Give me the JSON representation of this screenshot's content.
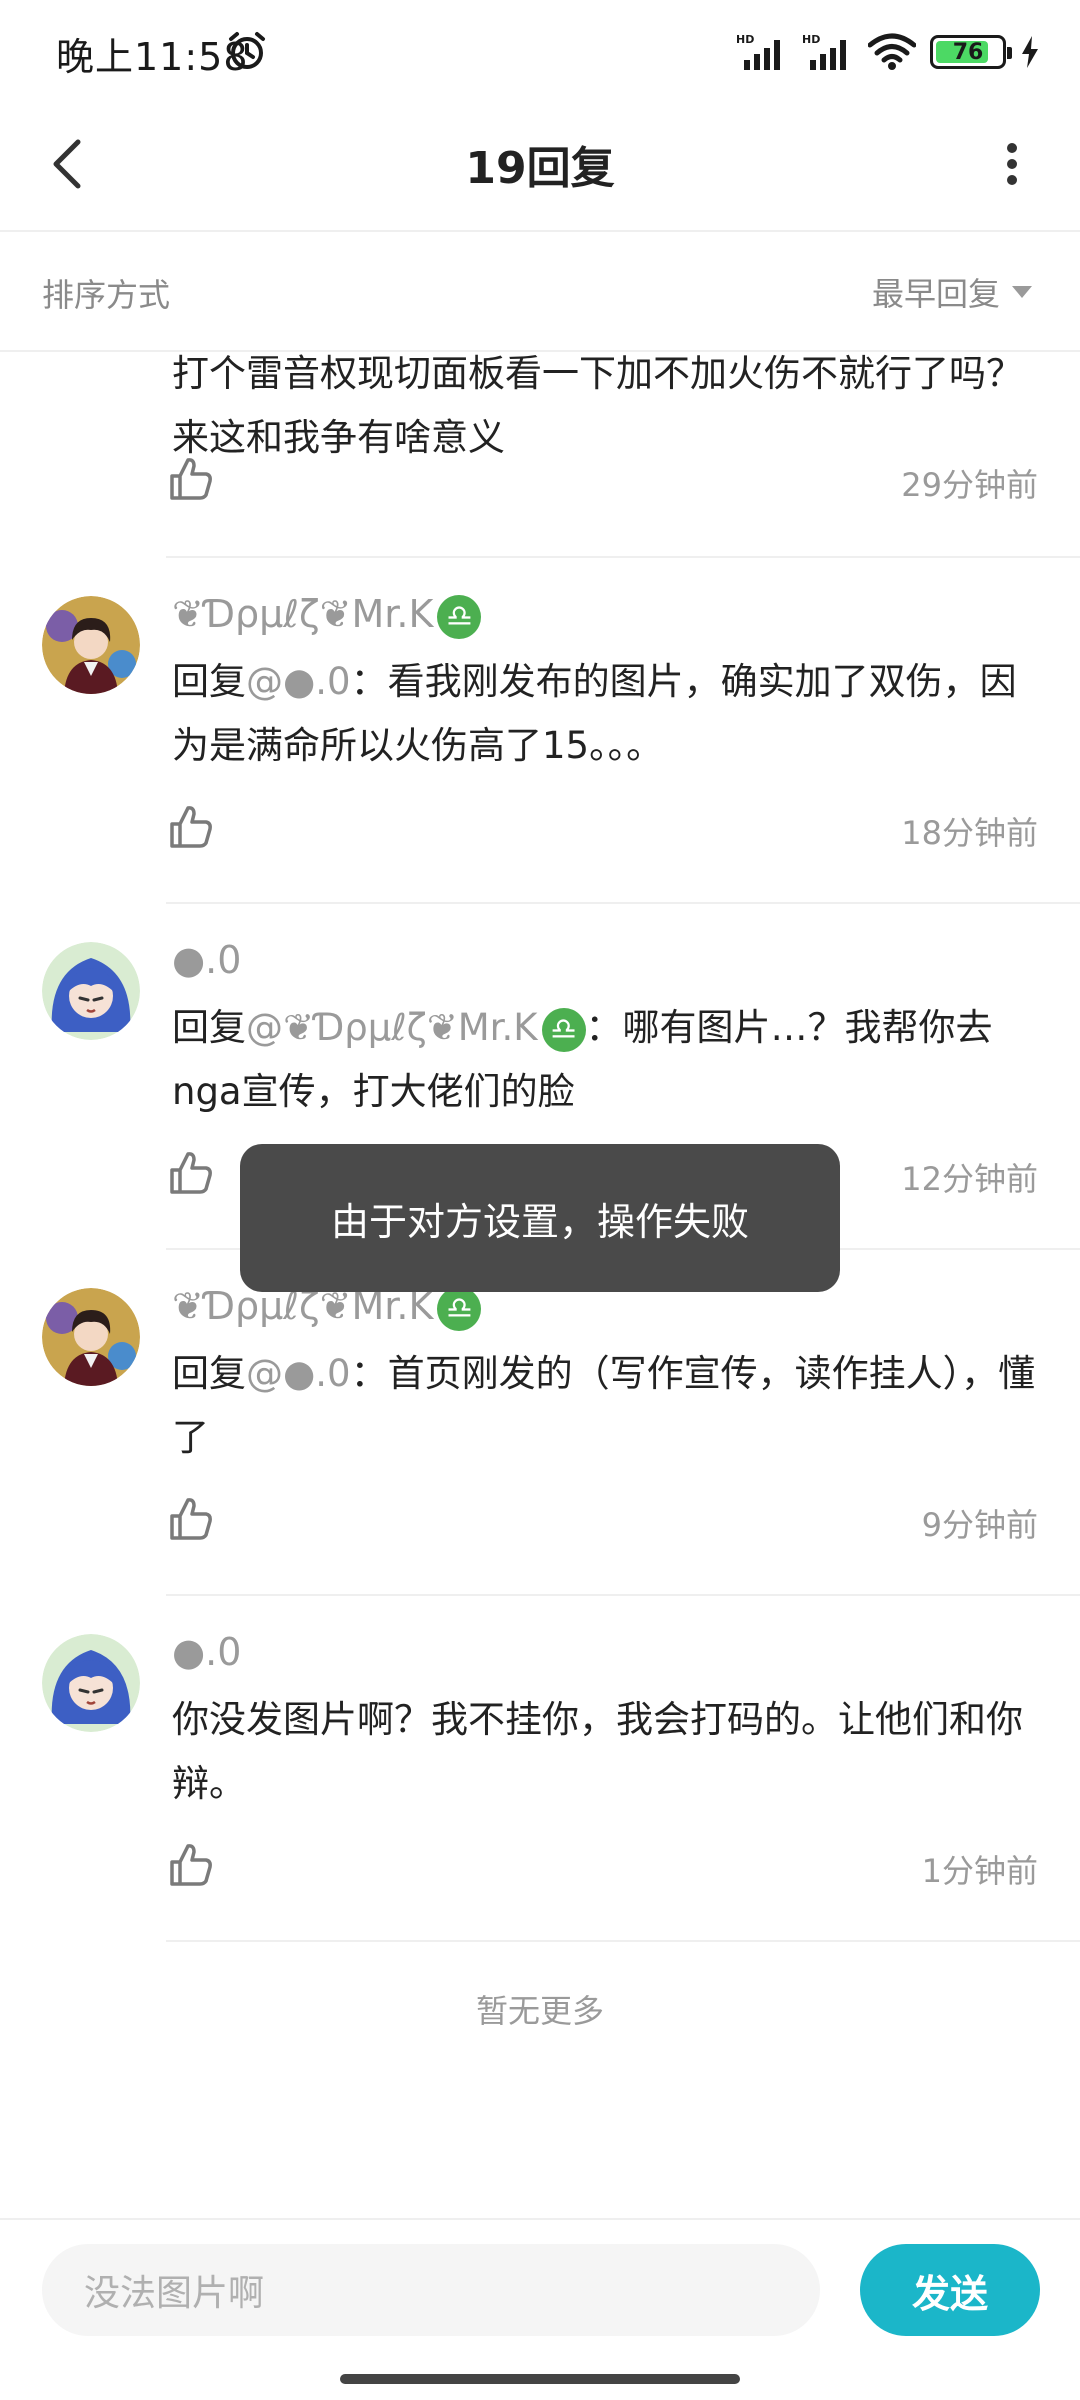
{
  "status_bar": {
    "time": "晚上11:58",
    "battery": "76"
  },
  "header": {
    "title": "19回复"
  },
  "sort": {
    "label": "排序方式",
    "selected": "最早回复"
  },
  "comments": [
    {
      "text": "打个雷音权现切面板看一下加不加火伤不就行了吗？来这和我争有啥意义",
      "time": "29分钟前"
    },
    {
      "user": "❦Ɗρµℓζ❦Mr.K",
      "reply_prefix": "回复",
      "mention": "@●.0",
      "text": "：看我刚发布的图片，确实加了双伤，因为是满命所以火伤高了15。。。",
      "time": "18分钟前"
    },
    {
      "user": "●.0",
      "reply_prefix": "回复",
      "mention": "@❦Ɗρµℓζ❦Mr.K",
      "text": "：哪有图片…？我帮你去nga宣传，打大佬们的脸",
      "time": "12分钟前"
    },
    {
      "user": "❦Ɗρµℓζ❦Mr.K",
      "reply_prefix": "回复",
      "mention": "@●.0",
      "text": "：首页刚发的（写作宣传，读作挂人），懂了",
      "time": "9分钟前"
    },
    {
      "user": "●.0",
      "text": "你没发图片啊？我不挂你，我会打码的。让他们和你辩。",
      "time": "1分钟前"
    }
  ],
  "list_footer": "暂无更多",
  "toast": "由于对方设置，操作失败",
  "input": {
    "placeholder": "没法图片啊",
    "send_label": "发送"
  },
  "colors": {
    "accent": "#1bb6c9",
    "badge": "#4caf50",
    "toast_bg": "#4a4a4a"
  },
  "icons": [
    "alarm-icon",
    "signal-icon",
    "wifi-icon",
    "battery-icon",
    "charging-icon",
    "back-arrow-icon",
    "more-vertical-icon",
    "dropdown-triangle-icon",
    "thumbs-up-icon",
    "libra-badge-icon"
  ]
}
